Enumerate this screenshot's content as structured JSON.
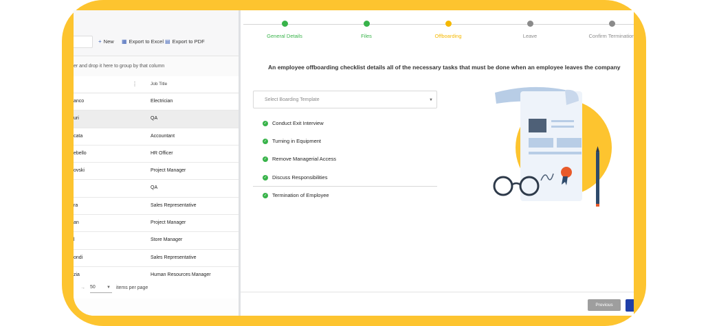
{
  "toolbar": {
    "search_value": "s",
    "new_label": "New",
    "export_excel_label": "Export to Excel",
    "export_pdf_label": "Export to PDF"
  },
  "grid": {
    "group_hint": "er and drop it here to group by that column",
    "job_title_header": "Job Title",
    "rows": [
      {
        "name": "anco",
        "job": "Electrician"
      },
      {
        "name": "uri",
        "job": "QA"
      },
      {
        "name": "cata",
        "job": "Accountant"
      },
      {
        "name": "ebello",
        "job": "HR Officer"
      },
      {
        "name": "ovski",
        "job": "Project Manager"
      },
      {
        "name": "",
        "job": "QA"
      },
      {
        "name": "ra",
        "job": "Sales Representative"
      },
      {
        "name": "an",
        "job": "Project Manager"
      },
      {
        "name": "l",
        "job": "Store Manager"
      },
      {
        "name": "ondi",
        "job": "Sales Representative"
      },
      {
        "name": "zia",
        "job": "Human Resources Manager"
      }
    ],
    "page_size": "50",
    "items_per_page": "items per page"
  },
  "wizard": {
    "steps": [
      {
        "label": "General Details",
        "state": "done",
        "color": "#38b34a"
      },
      {
        "label": "Files",
        "state": "done",
        "color": "#38b34a"
      },
      {
        "label": "Offboarding",
        "state": "active",
        "color": "#f5b800"
      },
      {
        "label": "Leave",
        "state": "pending",
        "color": "#8a8a8a"
      },
      {
        "label": "Confirm Termination",
        "state": "pending",
        "color": "#8a8a8a"
      }
    ],
    "description": "An employee offboarding checklist details all of the necessary tasks that must be done when an employee leaves the company",
    "template_placeholder": "Select Boarding Template",
    "tasks": [
      "Conduct Exit Interview",
      "Turning in Equipment",
      "Remove Managerial Access",
      "Discuss Responsibilities",
      "Termination of Employee"
    ],
    "previous_label": "Previous"
  },
  "colors": {
    "frame": "#fdc42f",
    "done": "#38b34a",
    "active": "#f5b800",
    "pending": "#8a8a8a",
    "accent_blue": "#1f3fa8"
  }
}
